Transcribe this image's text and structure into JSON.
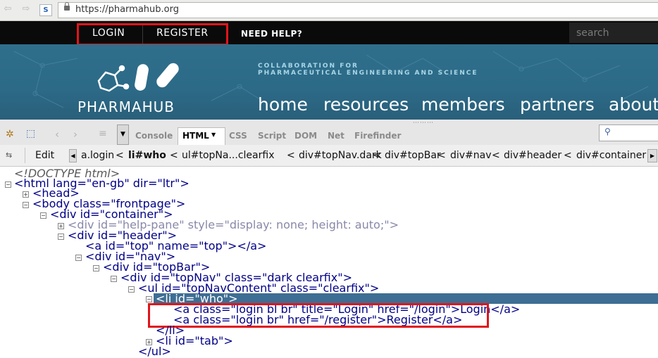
{
  "browser": {
    "url": "https://pharmahub.org"
  },
  "site": {
    "topnav": {
      "login": "LOGIN",
      "register": "REGISTER",
      "help": "NEED HELP?"
    },
    "search_placeholder": "search",
    "tagline_line1": "COLLABORATION FOR",
    "tagline_line2": "PHARMACEUTICAL ENGINEERING AND SCIENCE",
    "logo_text": "PHARMAHUB",
    "mainnav": [
      "home",
      "resources",
      "members",
      "partners",
      "about"
    ]
  },
  "firebug": {
    "tabs": [
      "Console",
      "HTML",
      "CSS",
      "Script",
      "DOM",
      "Net",
      "Firefinder"
    ],
    "active_tab": "HTML",
    "edit_label": "Edit",
    "breadcrumbs": [
      "a.login",
      "li#who",
      "ul#topNa...clearfix",
      "div#topNav.dark",
      "div#topBar",
      "div#nav",
      "div#header",
      "div#container"
    ],
    "crumb_separator": "<"
  },
  "tree": {
    "doctype": "<!DOCTYPE html>",
    "lines": {
      "html_open": "<html lang=\"en-gb\" dir=\"ltr\">",
      "head": "<head>",
      "body_open": "<body class=\"frontpage\">",
      "container_open": "<div id=\"container\">",
      "helppane": "<div id=\"help-pane\" style=\"display: none; height: auto;\">",
      "header_open": "<div id=\"header\">",
      "a_top": "<a id=\"top\" name=\"top\"></a>",
      "nav_open": "<div id=\"nav\">",
      "topbar_open": "<div id=\"topBar\">",
      "topnav_open": "<div id=\"topNav\" class=\"dark clearfix\">",
      "ul_open": "<ul id=\"topNavContent\" class=\"clearfix\">",
      "li_who": "<li id=\"who\">",
      "a_login": "<a class=\"login bl br\" title=\"Login\" href=\"/login\">Login</a>",
      "a_register": "<a class=\"login br\" href=\"/register\">Register</a>",
      "li_close": "</li>",
      "li_tab": "<li id=\"tab\">",
      "ul_close": "</ul>"
    }
  }
}
